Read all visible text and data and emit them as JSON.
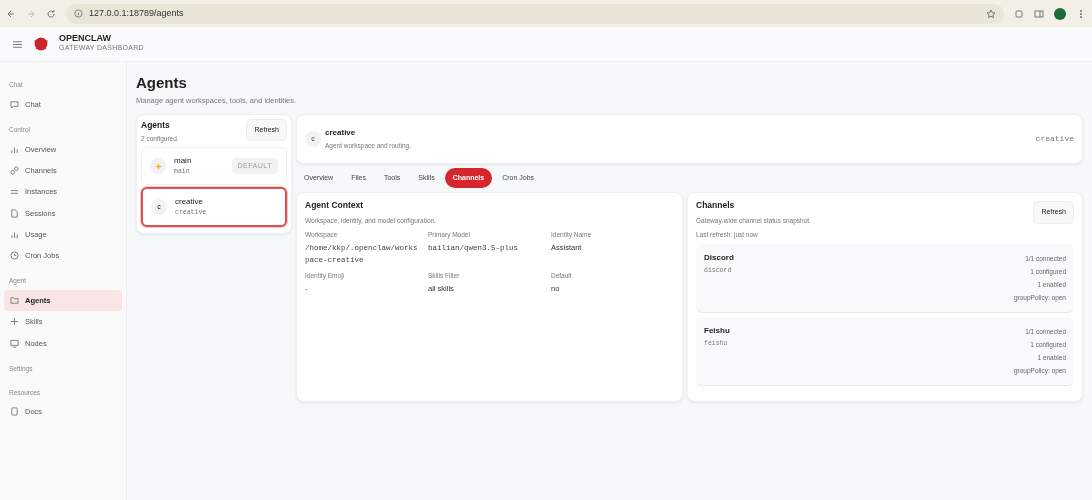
{
  "browser": {
    "url": "127.0.0.1:18789/agents"
  },
  "brand": {
    "name": "OPENCLAW",
    "subtitle": "GATEWAY DASHBOARD"
  },
  "sidebar": {
    "groups": [
      {
        "title": "Chat",
        "items": [
          {
            "label": "Chat",
            "selected": false
          }
        ]
      },
      {
        "title": "Control",
        "items": [
          {
            "label": "Overview",
            "selected": false
          },
          {
            "label": "Channels",
            "selected": false
          },
          {
            "label": "Instances",
            "selected": false
          },
          {
            "label": "Sessions",
            "selected": false
          },
          {
            "label": "Usage",
            "selected": false
          },
          {
            "label": "Cron Jobs",
            "selected": false
          }
        ]
      },
      {
        "title": "Agent",
        "items": [
          {
            "label": "Agents",
            "selected": true
          },
          {
            "label": "Skills",
            "selected": false
          },
          {
            "label": "Nodes",
            "selected": false
          }
        ]
      },
      {
        "title": "Settings"
      },
      {
        "title": "Resources",
        "items": [
          {
            "label": "Docs",
            "selected": false
          }
        ]
      }
    ]
  },
  "page": {
    "title": "Agents",
    "subtitle": "Manage agent workspaces, tools, and identities."
  },
  "agents_panel": {
    "title": "Agents",
    "count": "2 configured.",
    "refresh": "Refresh",
    "agents": [
      {
        "name": "main",
        "id": "main",
        "kind": "emoji",
        "badge": "DEFAULT",
        "selected": false
      },
      {
        "name": "creative",
        "id": "creative",
        "kind": "letter",
        "avatar": "c",
        "selected": true
      }
    ]
  },
  "agent_header": {
    "avatar": "c",
    "name": "creative",
    "subtitle": "Agent workspace and routing.",
    "id": "creative"
  },
  "tabs": [
    {
      "label": "Overview",
      "selected": false
    },
    {
      "label": "Files",
      "selected": false
    },
    {
      "label": "Tools",
      "selected": false
    },
    {
      "label": "Skills",
      "selected": false
    },
    {
      "label": "Channels",
      "selected": true
    },
    {
      "label": "Cron Jobs",
      "selected": false
    }
  ],
  "context": {
    "title": "Agent Context",
    "subtitle": "Workspace, identity, and model configuration.",
    "fields": [
      {
        "label": "Workspace",
        "value": "/home/kkp/.openclaw/workspace-creative",
        "kind": "code"
      },
      {
        "label": "Primary Model",
        "value": "bailian/qwen3.5-plus",
        "kind": "code"
      },
      {
        "label": "Identity Name",
        "value": "Assistant",
        "kind": "text"
      },
      {
        "label": "Identity Emoji",
        "value": "-",
        "kind": "text"
      },
      {
        "label": "Skills Filter",
        "value": "all skills",
        "kind": "text"
      },
      {
        "label": "Default",
        "value": "no",
        "kind": "text"
      }
    ]
  },
  "channels": {
    "title": "Channels",
    "subtitle": "Gateway-wide channel status snapshot.",
    "last_refresh": "Last refresh: just now",
    "refresh": "Refresh",
    "items": [
      {
        "name": "Discord",
        "id": "discord",
        "stats": [
          "1/1 connected",
          "1 configured",
          "1 enabled",
          "groupPolicy: open"
        ]
      },
      {
        "name": "Feishu",
        "id": "feishu",
        "stats": [
          "1/1 connected",
          "1 configured",
          "1 enabled",
          "groupPolicy: open"
        ]
      }
    ]
  }
}
